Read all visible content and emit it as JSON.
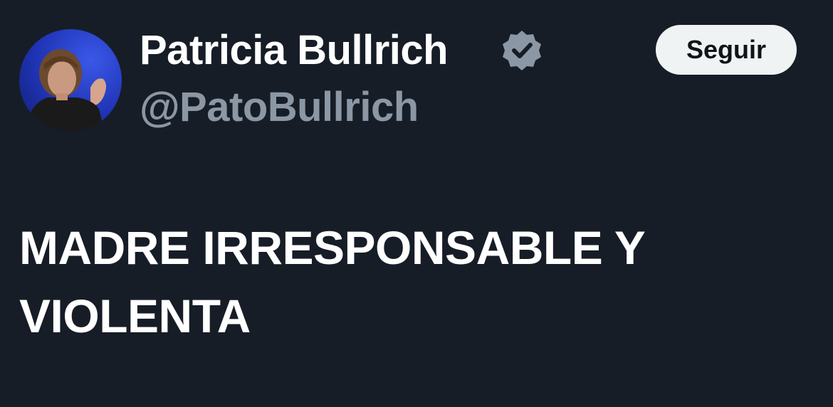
{
  "author": {
    "display_name": "Patricia Bullrich",
    "handle": "@PatoBullrich",
    "verified_icon": "verified-badge-icon",
    "avatar": "profile-photo"
  },
  "actions": {
    "follow_label": "Seguir"
  },
  "tweet": {
    "line1": "MADRE IRRESPONSABLE Y",
    "line2": "VIOLENTA"
  },
  "colors": {
    "background": "#161d27",
    "text_primary": "#ffffff",
    "text_secondary": "#8b97a4",
    "button_bg": "#eff3f4",
    "button_text": "#0f1419",
    "badge": "#8b97a4"
  }
}
